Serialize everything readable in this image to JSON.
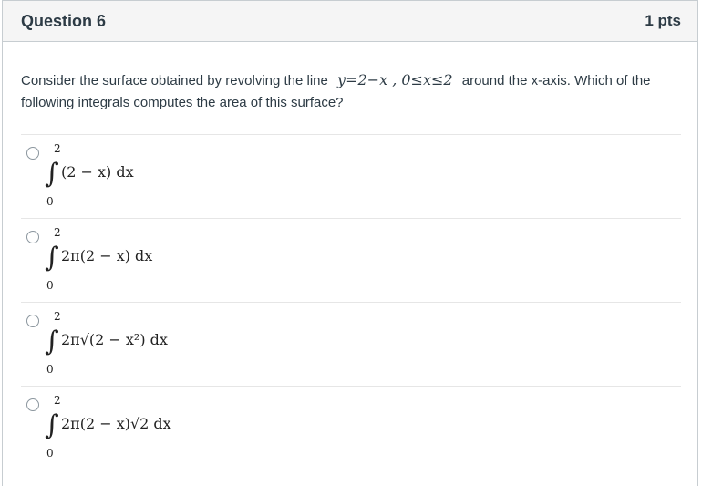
{
  "header": {
    "title": "Question 6",
    "points": "1 pts"
  },
  "prompt": {
    "before": "Consider the surface obtained by revolving the line",
    "math": "y=2−x , 0≤x≤2",
    "after": "around the x-axis. Which of the following integrals computes the area of this surface?"
  },
  "answers": [
    {
      "upper": "2",
      "lower": "0",
      "integrand": "(2 − x) dx"
    },
    {
      "upper": "2",
      "lower": "0",
      "integrand": "2π(2 − x) dx"
    },
    {
      "upper": "2",
      "lower": "0",
      "integrand": "2π√(2 − x²) dx"
    },
    {
      "upper": "2",
      "lower": "0",
      "integrand": "2π(2 − x)√2 dx"
    }
  ]
}
